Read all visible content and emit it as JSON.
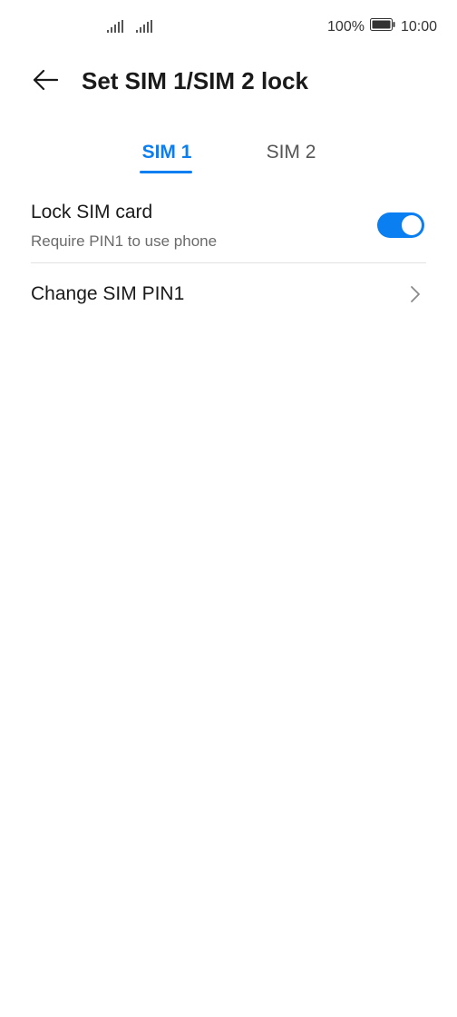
{
  "status_bar": {
    "battery_percent": "100%",
    "time": "10:00"
  },
  "header": {
    "title": "Set SIM 1/SIM 2 lock"
  },
  "tabs": [
    {
      "label": "SIM 1",
      "selected": true
    },
    {
      "label": "SIM 2",
      "selected": false
    }
  ],
  "settings": {
    "lock_sim": {
      "title": "Lock SIM card",
      "subtitle": "Require PIN1 to use phone",
      "enabled": true
    },
    "change_pin": {
      "title": "Change SIM PIN1"
    }
  },
  "colors": {
    "accent": "#0a7ff2",
    "text_primary": "#1a1a1a",
    "text_secondary": "#6b6b6b",
    "divider": "#e2e2e2"
  },
  "icons": {
    "back": "back-arrow-icon",
    "signal": "signal-strength-icon",
    "battery": "battery-icon",
    "chevron": "chevron-right-icon"
  }
}
